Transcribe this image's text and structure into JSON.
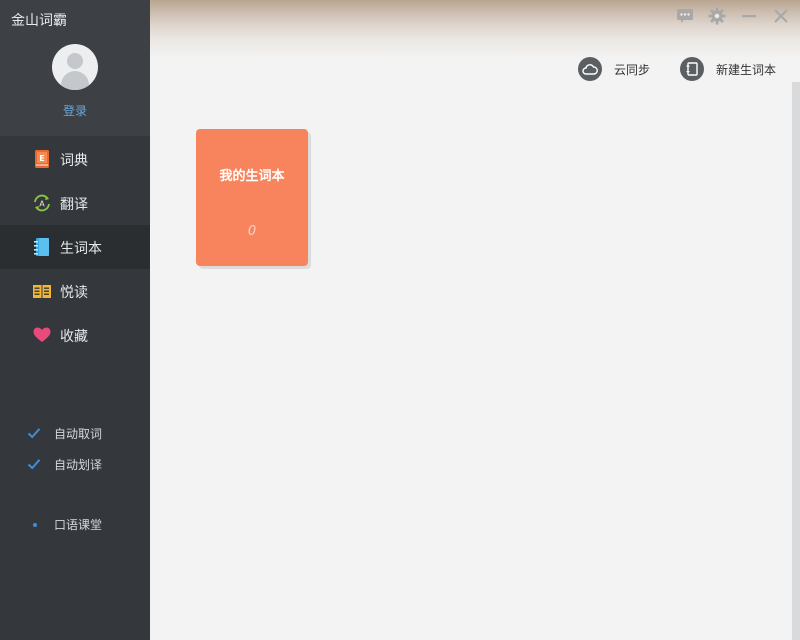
{
  "app": {
    "title": "金山词霸"
  },
  "user": {
    "login_label": "登录"
  },
  "nav": [
    {
      "label": "词典",
      "icon": "dictionary-book-icon",
      "active": false
    },
    {
      "label": "翻译",
      "icon": "translate-icon",
      "active": false
    },
    {
      "label": "生词本",
      "icon": "vocabulary-notebook-icon",
      "active": true
    },
    {
      "label": "悦读",
      "icon": "reading-book-icon",
      "active": false
    },
    {
      "label": "收藏",
      "icon": "heart-icon",
      "active": false
    }
  ],
  "settings": {
    "auto_lookup": {
      "label": "自动取词",
      "checked": true
    },
    "auto_select_translate": {
      "label": "自动划译",
      "checked": true
    }
  },
  "oral_class": {
    "label": "口语课堂"
  },
  "toolbar": {
    "cloud_sync_label": "云同步",
    "new_wordbook_label": "新建生词本"
  },
  "wordbooks": [
    {
      "title": "我的生词本",
      "count": "0"
    }
  ],
  "colors": {
    "sidebar_bg": "#34383c",
    "active_bg": "#2b2e31",
    "accent_blue": "#3c8fd8",
    "book_color": "#f7845d"
  }
}
